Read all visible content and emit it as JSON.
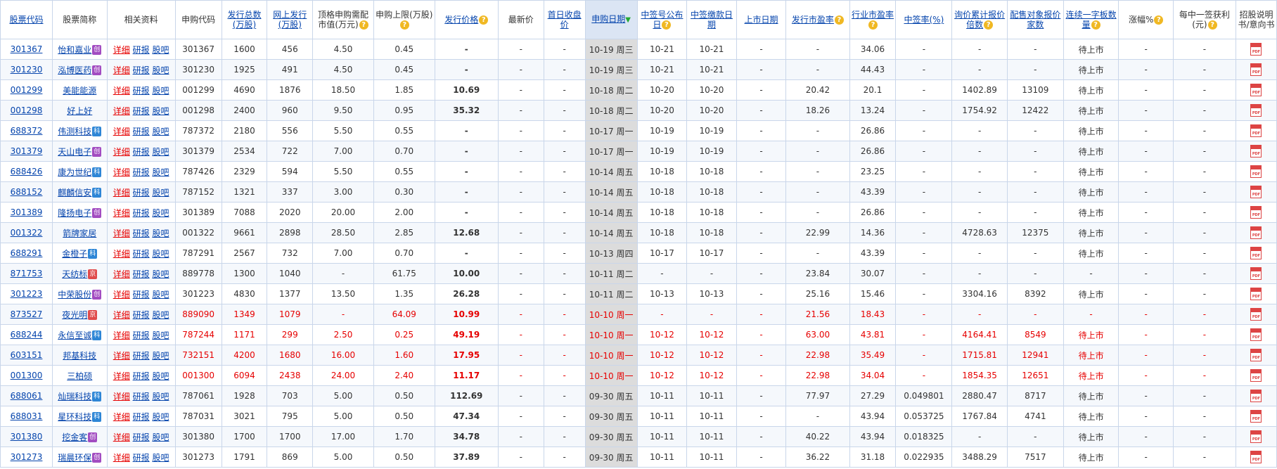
{
  "headers": [
    {
      "label": "股票代码",
      "link": true
    },
    {
      "label": "股票简称"
    },
    {
      "label": "相关资料"
    },
    {
      "label": "申购代码"
    },
    {
      "label": "发行总数(万股)",
      "link": true
    },
    {
      "label": "网上发行(万股)",
      "link": true
    },
    {
      "label": "顶格申购需配市值(万元)",
      "help": true
    },
    {
      "label": "申购上限(万股)",
      "help": true
    },
    {
      "label": "发行价格",
      "link": true,
      "help": true
    },
    {
      "label": "最新价"
    },
    {
      "label": "首日收盘价",
      "link": true
    },
    {
      "label": "申购日期",
      "link": true,
      "sort": true
    },
    {
      "label": "中签号公布日",
      "link": true,
      "help": true
    },
    {
      "label": "中签缴款日期",
      "link": true
    },
    {
      "label": "上市日期",
      "link": true
    },
    {
      "label": "发行市盈率",
      "link": true,
      "help": true
    },
    {
      "label": "行业市盈率",
      "link": true,
      "help": true
    },
    {
      "label": "中签率(%)",
      "link": true
    },
    {
      "label": "询价累计报价倍数",
      "link": true,
      "help": true
    },
    {
      "label": "配售对象报价家数",
      "link": true
    },
    {
      "label": "连续一字板数量",
      "link": true,
      "help": true
    },
    {
      "label": "涨幅%",
      "help": true
    },
    {
      "label": "每中一签获利(元)",
      "help": true
    },
    {
      "label": "招股说明书/意向书"
    }
  ],
  "links": {
    "detail": "详细",
    "research": "研报",
    "forum": "股吧"
  },
  "badges": {
    "chuang": "创",
    "ke": "科",
    "jing": "京"
  },
  "icons": {
    "help": "help-icon",
    "sort": "sort-arrow-down-icon",
    "pdf": "pdf-icon"
  },
  "colors": {
    "highlight": "#e60000",
    "link": "#0645ad",
    "sort_column": "#dcdcdc"
  },
  "rows": [
    {
      "code": "301367",
      "name": "怡和嘉业",
      "badge": "chuang",
      "sub_code": "301367",
      "total": "1600",
      "online": "456",
      "mkt": "4.50",
      "limit": "0.45",
      "price": "-",
      "latest": "-",
      "first_close": "-",
      "date": "10-19 周三",
      "pub": "10-21",
      "pay": "10-21",
      "list": "-",
      "pe": "-",
      "ind_pe": "34.06",
      "rate": "-",
      "mult": "-",
      "bidders": "-",
      "boards": "待上市",
      "gain": "-",
      "profit": "-",
      "hl": false
    },
    {
      "code": "301230",
      "name": "泓博医药",
      "badge": "chuang",
      "sub_code": "301230",
      "total": "1925",
      "online": "491",
      "mkt": "4.50",
      "limit": "0.45",
      "price": "-",
      "latest": "-",
      "first_close": "-",
      "date": "10-19 周三",
      "pub": "10-21",
      "pay": "10-21",
      "list": "-",
      "pe": "-",
      "ind_pe": "44.43",
      "rate": "-",
      "mult": "-",
      "bidders": "-",
      "boards": "待上市",
      "gain": "-",
      "profit": "-",
      "hl": false
    },
    {
      "code": "001299",
      "name": "美能能源",
      "badge": "",
      "sub_code": "001299",
      "total": "4690",
      "online": "1876",
      "mkt": "18.50",
      "limit": "1.85",
      "price": "10.69",
      "latest": "-",
      "first_close": "-",
      "date": "10-18 周二",
      "pub": "10-20",
      "pay": "10-20",
      "list": "-",
      "pe": "20.42",
      "ind_pe": "20.1",
      "rate": "-",
      "mult": "1402.89",
      "bidders": "13109",
      "boards": "待上市",
      "gain": "-",
      "profit": "-",
      "hl": false
    },
    {
      "code": "001298",
      "name": "好上好",
      "badge": "",
      "sub_code": "001298",
      "total": "2400",
      "online": "960",
      "mkt": "9.50",
      "limit": "0.95",
      "price": "35.32",
      "latest": "-",
      "first_close": "-",
      "date": "10-18 周二",
      "pub": "10-20",
      "pay": "10-20",
      "list": "-",
      "pe": "18.26",
      "ind_pe": "13.24",
      "rate": "-",
      "mult": "1754.92",
      "bidders": "12422",
      "boards": "待上市",
      "gain": "-",
      "profit": "-",
      "hl": false
    },
    {
      "code": "688372",
      "name": "伟测科技",
      "badge": "ke",
      "sub_code": "787372",
      "total": "2180",
      "online": "556",
      "mkt": "5.50",
      "limit": "0.55",
      "price": "-",
      "latest": "-",
      "first_close": "-",
      "date": "10-17 周一",
      "pub": "10-19",
      "pay": "10-19",
      "list": "-",
      "pe": "-",
      "ind_pe": "26.86",
      "rate": "-",
      "mult": "-",
      "bidders": "-",
      "boards": "待上市",
      "gain": "-",
      "profit": "-",
      "hl": false
    },
    {
      "code": "301379",
      "name": "天山电子",
      "badge": "chuang",
      "sub_code": "301379",
      "total": "2534",
      "online": "722",
      "mkt": "7.00",
      "limit": "0.70",
      "price": "-",
      "latest": "-",
      "first_close": "-",
      "date": "10-17 周一",
      "pub": "10-19",
      "pay": "10-19",
      "list": "-",
      "pe": "-",
      "ind_pe": "26.86",
      "rate": "-",
      "mult": "-",
      "bidders": "-",
      "boards": "待上市",
      "gain": "-",
      "profit": "-",
      "hl": false
    },
    {
      "code": "688426",
      "name": "康为世纪",
      "badge": "ke",
      "sub_code": "787426",
      "total": "2329",
      "online": "594",
      "mkt": "5.50",
      "limit": "0.55",
      "price": "-",
      "latest": "-",
      "first_close": "-",
      "date": "10-14 周五",
      "pub": "10-18",
      "pay": "10-18",
      "list": "-",
      "pe": "-",
      "ind_pe": "23.25",
      "rate": "-",
      "mult": "-",
      "bidders": "-",
      "boards": "待上市",
      "gain": "-",
      "profit": "-",
      "hl": false
    },
    {
      "code": "688152",
      "name": "麒麟信安",
      "badge": "ke",
      "sub_code": "787152",
      "total": "1321",
      "online": "337",
      "mkt": "3.00",
      "limit": "0.30",
      "price": "-",
      "latest": "-",
      "first_close": "-",
      "date": "10-14 周五",
      "pub": "10-18",
      "pay": "10-18",
      "list": "-",
      "pe": "-",
      "ind_pe": "43.39",
      "rate": "-",
      "mult": "-",
      "bidders": "-",
      "boards": "待上市",
      "gain": "-",
      "profit": "-",
      "hl": false
    },
    {
      "code": "301389",
      "name": "隆扬电子",
      "badge": "chuang",
      "sub_code": "301389",
      "total": "7088",
      "online": "2020",
      "mkt": "20.00",
      "limit": "2.00",
      "price": "-",
      "latest": "-",
      "first_close": "-",
      "date": "10-14 周五",
      "pub": "10-18",
      "pay": "10-18",
      "list": "-",
      "pe": "-",
      "ind_pe": "26.86",
      "rate": "-",
      "mult": "-",
      "bidders": "-",
      "boards": "待上市",
      "gain": "-",
      "profit": "-",
      "hl": false
    },
    {
      "code": "001322",
      "name": "箭牌家居",
      "badge": "",
      "sub_code": "001322",
      "total": "9661",
      "online": "2898",
      "mkt": "28.50",
      "limit": "2.85",
      "price": "12.68",
      "latest": "-",
      "first_close": "-",
      "date": "10-14 周五",
      "pub": "10-18",
      "pay": "10-18",
      "list": "-",
      "pe": "22.99",
      "ind_pe": "14.36",
      "rate": "-",
      "mult": "4728.63",
      "bidders": "12375",
      "boards": "待上市",
      "gain": "-",
      "profit": "-",
      "hl": false
    },
    {
      "code": "688291",
      "name": "金橙子",
      "badge": "ke",
      "sub_code": "787291",
      "total": "2567",
      "online": "732",
      "mkt": "7.00",
      "limit": "0.70",
      "price": "-",
      "latest": "-",
      "first_close": "-",
      "date": "10-13 周四",
      "pub": "10-17",
      "pay": "10-17",
      "list": "-",
      "pe": "-",
      "ind_pe": "43.39",
      "rate": "-",
      "mult": "-",
      "bidders": "-",
      "boards": "待上市",
      "gain": "-",
      "profit": "-",
      "hl": false
    },
    {
      "code": "871753",
      "name": "天纺标",
      "badge": "jing",
      "sub_code": "889778",
      "total": "1300",
      "online": "1040",
      "mkt": "-",
      "limit": "61.75",
      "price": "10.00",
      "latest": "-",
      "first_close": "-",
      "date": "10-11 周二",
      "pub": "-",
      "pay": "-",
      "list": "-",
      "pe": "23.84",
      "ind_pe": "30.07",
      "rate": "-",
      "mult": "-",
      "bidders": "-",
      "boards": "-",
      "gain": "-",
      "profit": "-",
      "hl": false
    },
    {
      "code": "301223",
      "name": "中荣股份",
      "badge": "chuang",
      "sub_code": "301223",
      "total": "4830",
      "online": "1377",
      "mkt": "13.50",
      "limit": "1.35",
      "price": "26.28",
      "latest": "-",
      "first_close": "-",
      "date": "10-11 周二",
      "pub": "10-13",
      "pay": "10-13",
      "list": "-",
      "pe": "25.16",
      "ind_pe": "15.46",
      "rate": "-",
      "mult": "3304.16",
      "bidders": "8392",
      "boards": "待上市",
      "gain": "-",
      "profit": "-",
      "hl": false
    },
    {
      "code": "873527",
      "name": "夜光明",
      "badge": "jing",
      "sub_code": "889090",
      "total": "1349",
      "online": "1079",
      "mkt": "-",
      "limit": "64.09",
      "price": "10.99",
      "latest": "-",
      "first_close": "-",
      "date": "10-10 周一",
      "pub": "-",
      "pay": "-",
      "list": "-",
      "pe": "21.56",
      "ind_pe": "18.43",
      "rate": "-",
      "mult": "-",
      "bidders": "-",
      "boards": "-",
      "gain": "-",
      "profit": "-",
      "hl": true
    },
    {
      "code": "688244",
      "name": "永信至诚",
      "badge": "ke",
      "sub_code": "787244",
      "total": "1171",
      "online": "299",
      "mkt": "2.50",
      "limit": "0.25",
      "price": "49.19",
      "latest": "-",
      "first_close": "-",
      "date": "10-10 周一",
      "pub": "10-12",
      "pay": "10-12",
      "list": "-",
      "pe": "63.00",
      "ind_pe": "43.81",
      "rate": "-",
      "mult": "4164.41",
      "bidders": "8549",
      "boards": "待上市",
      "gain": "-",
      "profit": "-",
      "hl": true
    },
    {
      "code": "603151",
      "name": "邦基科技",
      "badge": "",
      "sub_code": "732151",
      "total": "4200",
      "online": "1680",
      "mkt": "16.00",
      "limit": "1.60",
      "price": "17.95",
      "latest": "-",
      "first_close": "-",
      "date": "10-10 周一",
      "pub": "10-12",
      "pay": "10-12",
      "list": "-",
      "pe": "22.98",
      "ind_pe": "35.49",
      "rate": "-",
      "mult": "1715.81",
      "bidders": "12941",
      "boards": "待上市",
      "gain": "-",
      "profit": "-",
      "hl": true
    },
    {
      "code": "001300",
      "name": "三柏硕",
      "badge": "",
      "sub_code": "001300",
      "total": "6094",
      "online": "2438",
      "mkt": "24.00",
      "limit": "2.40",
      "price": "11.17",
      "latest": "-",
      "first_close": "-",
      "date": "10-10 周一",
      "pub": "10-12",
      "pay": "10-12",
      "list": "-",
      "pe": "22.98",
      "ind_pe": "34.04",
      "rate": "-",
      "mult": "1854.35",
      "bidders": "12651",
      "boards": "待上市",
      "gain": "-",
      "profit": "-",
      "hl": true
    },
    {
      "code": "688061",
      "name": "灿瑞科技",
      "badge": "ke",
      "sub_code": "787061",
      "total": "1928",
      "online": "703",
      "mkt": "5.00",
      "limit": "0.50",
      "price": "112.69",
      "latest": "-",
      "first_close": "-",
      "date": "09-30 周五",
      "pub": "10-11",
      "pay": "10-11",
      "list": "-",
      "pe": "77.97",
      "ind_pe": "27.29",
      "rate": "0.049801",
      "mult": "2880.47",
      "bidders": "8717",
      "boards": "待上市",
      "gain": "-",
      "profit": "-",
      "hl": false
    },
    {
      "code": "688031",
      "name": "星环科技",
      "badge": "ke",
      "sub_code": "787031",
      "total": "3021",
      "online": "795",
      "mkt": "5.00",
      "limit": "0.50",
      "price": "47.34",
      "latest": "-",
      "first_close": "-",
      "date": "09-30 周五",
      "pub": "10-11",
      "pay": "10-11",
      "list": "-",
      "pe": "-",
      "ind_pe": "43.94",
      "rate": "0.053725",
      "mult": "1767.84",
      "bidders": "4741",
      "boards": "待上市",
      "gain": "-",
      "profit": "-",
      "hl": false
    },
    {
      "code": "301380",
      "name": "挖金客",
      "badge": "chuang",
      "sub_code": "301380",
      "total": "1700",
      "online": "1700",
      "mkt": "17.00",
      "limit": "1.70",
      "price": "34.78",
      "latest": "-",
      "first_close": "-",
      "date": "09-30 周五",
      "pub": "10-11",
      "pay": "10-11",
      "list": "-",
      "pe": "40.22",
      "ind_pe": "43.94",
      "rate": "0.018325",
      "mult": "-",
      "bidders": "-",
      "boards": "待上市",
      "gain": "-",
      "profit": "-",
      "hl": false
    },
    {
      "code": "301273",
      "name": "瑞晨环保",
      "badge": "chuang",
      "sub_code": "301273",
      "total": "1791",
      "online": "869",
      "mkt": "5.00",
      "limit": "0.50",
      "price": "37.89",
      "latest": "-",
      "first_close": "-",
      "date": "09-30 周五",
      "pub": "10-11",
      "pay": "10-11",
      "list": "-",
      "pe": "36.22",
      "ind_pe": "31.18",
      "rate": "0.022935",
      "mult": "3488.29",
      "bidders": "7517",
      "boards": "待上市",
      "gain": "-",
      "profit": "-",
      "hl": false
    }
  ]
}
